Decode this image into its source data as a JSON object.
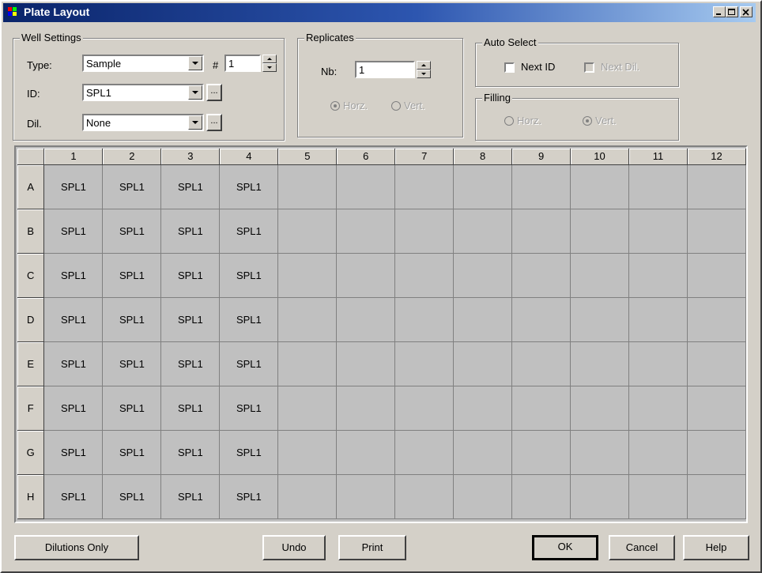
{
  "window": {
    "title": "Plate Layout"
  },
  "well_settings": {
    "group_label": "Well Settings",
    "type_label": "Type:",
    "type_value": "Sample",
    "hash_label": "#",
    "number_value": "1",
    "id_label": "ID:",
    "id_value": "SPL1",
    "dil_label": "Dil.",
    "dil_value": "None",
    "browse_label": "..."
  },
  "replicates": {
    "group_label": "Replicates",
    "nb_label": "Nb:",
    "nb_value": "1",
    "horz_label": "Horz.",
    "vert_label": "Vert."
  },
  "auto_select": {
    "group_label": "Auto Select",
    "next_id_label": "Next ID",
    "next_dil_label": "Next Dil."
  },
  "filling": {
    "group_label": "Filling",
    "horz_label": "Horz.",
    "vert_label": "Vert."
  },
  "plate": {
    "columns": [
      "1",
      "2",
      "3",
      "4",
      "5",
      "6",
      "7",
      "8",
      "9",
      "10",
      "11",
      "12"
    ],
    "rows": [
      {
        "label": "A",
        "wells": [
          "SPL1",
          "SPL1",
          "SPL1",
          "SPL1",
          "",
          "",
          "",
          "",
          "",
          "",
          "",
          ""
        ]
      },
      {
        "label": "B",
        "wells": [
          "SPL1",
          "SPL1",
          "SPL1",
          "SPL1",
          "",
          "",
          "",
          "",
          "",
          "",
          "",
          ""
        ]
      },
      {
        "label": "C",
        "wells": [
          "SPL1",
          "SPL1",
          "SPL1",
          "SPL1",
          "",
          "",
          "",
          "",
          "",
          "",
          "",
          ""
        ]
      },
      {
        "label": "D",
        "wells": [
          "SPL1",
          "SPL1",
          "SPL1",
          "SPL1",
          "",
          "",
          "",
          "",
          "",
          "",
          "",
          ""
        ]
      },
      {
        "label": "E",
        "wells": [
          "SPL1",
          "SPL1",
          "SPL1",
          "SPL1",
          "",
          "",
          "",
          "",
          "",
          "",
          "",
          ""
        ]
      },
      {
        "label": "F",
        "wells": [
          "SPL1",
          "SPL1",
          "SPL1",
          "SPL1",
          "",
          "",
          "",
          "",
          "",
          "",
          "",
          ""
        ]
      },
      {
        "label": "G",
        "wells": [
          "SPL1",
          "SPL1",
          "SPL1",
          "SPL1",
          "",
          "",
          "",
          "",
          "",
          "",
          "",
          ""
        ]
      },
      {
        "label": "H",
        "wells": [
          "SPL1",
          "SPL1",
          "SPL1",
          "SPL1",
          "",
          "",
          "",
          "",
          "",
          "",
          "",
          ""
        ]
      }
    ]
  },
  "buttons": {
    "dilutions_only": "Dilutions Only",
    "undo": "Undo",
    "print": "Print",
    "ok": "OK",
    "cancel": "Cancel",
    "help": "Help"
  },
  "colors": {
    "titlebar_start": "#0a246a",
    "titlebar_end": "#a6caf0",
    "face": "#d4d0c8"
  }
}
